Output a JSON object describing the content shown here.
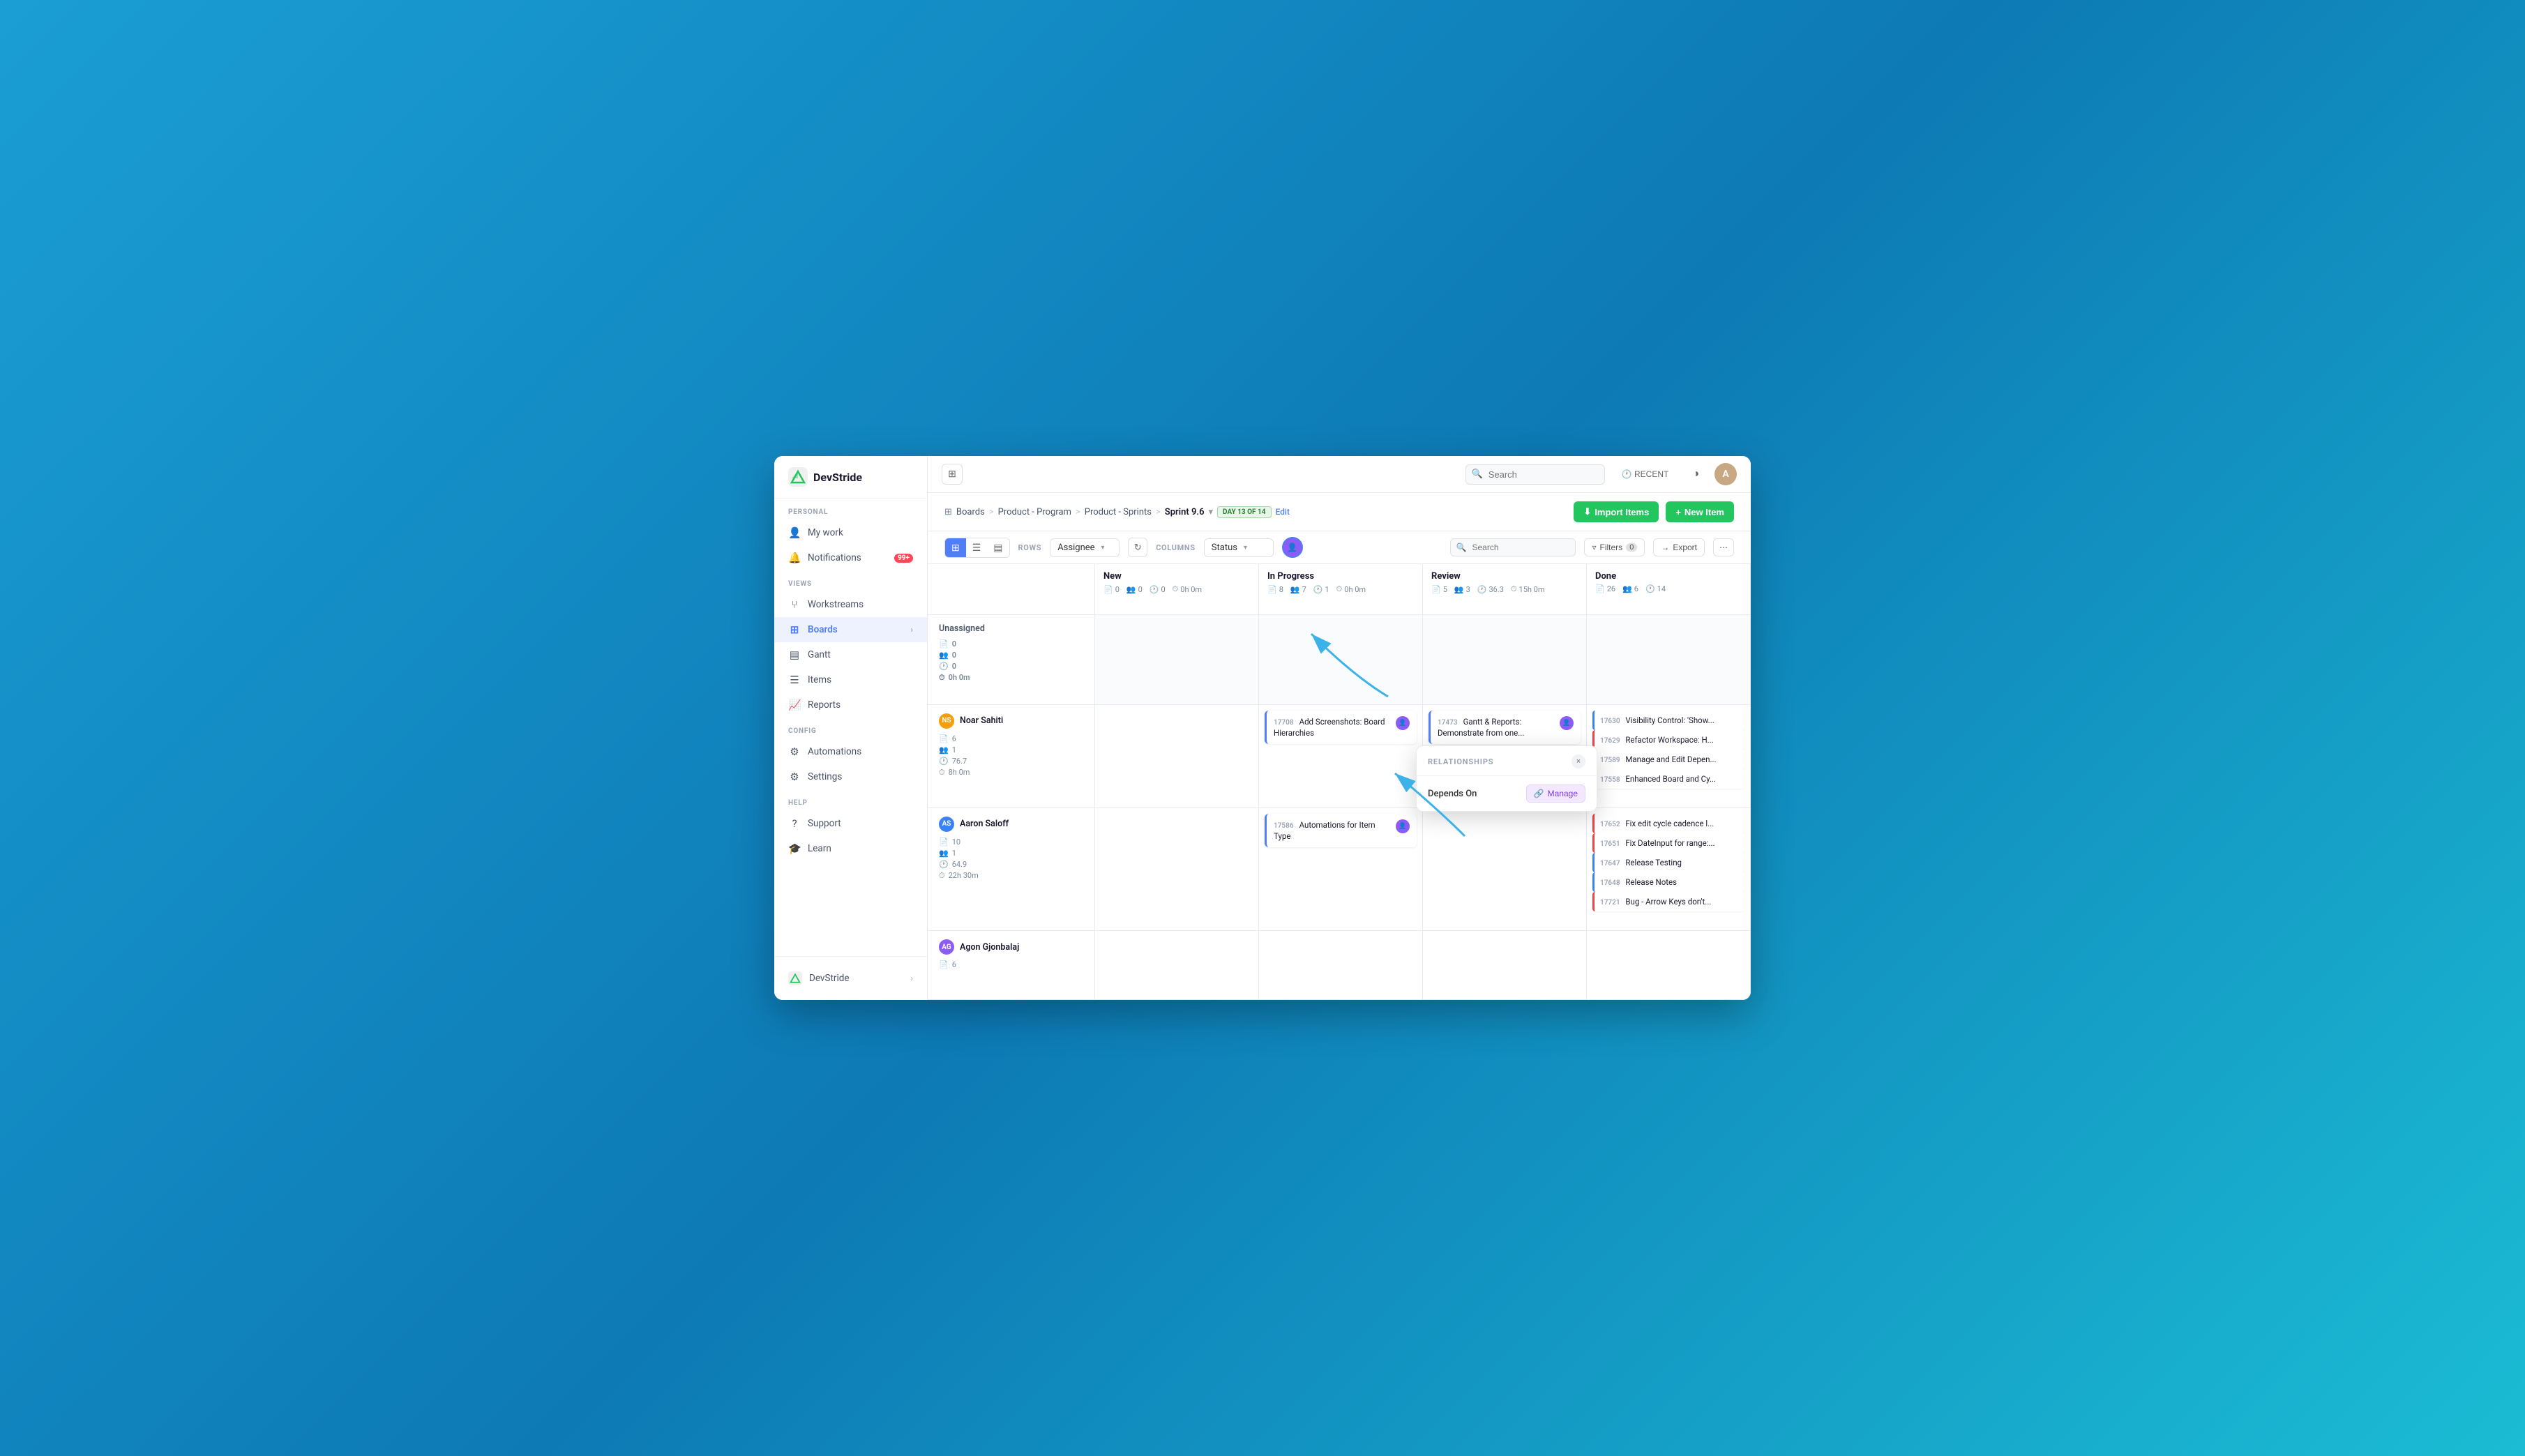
{
  "app": {
    "name": "DevStride",
    "logo_text": "DevStride"
  },
  "topbar": {
    "expand_icon": "⊞",
    "search_placeholder": "Search",
    "recent_label": "RECENT",
    "theme_icon": "◑",
    "avatar_letter": "A"
  },
  "breadcrumb": {
    "boards_label": "Boards",
    "sep1": ">",
    "program_label": "Product - Program",
    "sep2": ">",
    "sprints_label": "Product - Sprints",
    "sep3": ">",
    "sprint_label": "Sprint 9.6",
    "sprint_badge": "DAY 13 OF 14",
    "edit_label": "Edit"
  },
  "header_actions": {
    "import_label": "Import Items",
    "new_label": "New Item"
  },
  "toolbar": {
    "rows_label": "ROWS",
    "rows_value": "Assignee",
    "columns_label": "COLUMNS",
    "columns_value": "Status",
    "search_placeholder": "Search",
    "filters_label": "Filters",
    "filters_count": "0",
    "export_label": "Export"
  },
  "view_buttons": [
    "grid-icon",
    "list-icon",
    "table-icon"
  ],
  "board": {
    "columns": [
      {
        "id": "row-header",
        "title": "",
        "stats": []
      },
      {
        "id": "new",
        "title": "New",
        "stat_doc": "0",
        "stat_users": "0",
        "stat_clock": "0",
        "stat_time": "0h 0m"
      },
      {
        "id": "in-progress",
        "title": "In Progress",
        "stat_doc": "8",
        "stat_users": "7",
        "stat_clock": "1",
        "stat_time": "0h 0m"
      },
      {
        "id": "review",
        "title": "Review",
        "stat_doc": "5",
        "stat_users": "3",
        "stat_clock": "36.3",
        "stat_time": "15h 0m"
      },
      {
        "id": "done",
        "title": "Done",
        "stat_doc": "26",
        "stat_users": "6",
        "stat_clock": "14",
        "stat_time": ""
      }
    ],
    "rows": [
      {
        "id": "unassigned",
        "name": "Unassigned",
        "avatar_text": "",
        "avatar_color": "#e0e0e0",
        "stat_doc": "0",
        "stat_users": "0",
        "stat_clock": "0",
        "stat_time": "0h 0m",
        "new_cards": [],
        "in_progress_cards": [],
        "review_cards": [],
        "done_cards": []
      },
      {
        "id": "noar-sahiti",
        "name": "Noar Sahiti",
        "avatar_text": "NS",
        "avatar_color": "#f59e0b",
        "stat_doc": "6",
        "stat_users": "1",
        "stat_clock": "76.7",
        "stat_time": "8h 0m",
        "new_cards": [],
        "in_progress_cards": [
          {
            "id": "17708",
            "title": "Add Screenshots: Board Hierarchies",
            "color": "#4f7ef8"
          }
        ],
        "review_cards": [
          {
            "id": "17473",
            "title": "Gantt & Reports: Demonstrate from one...",
            "color": "#4f7ef8"
          }
        ],
        "done_cards": [
          {
            "id": "17630",
            "title": "Visibility Control: 'Show...",
            "color": "#3b82f6"
          }
        ]
      },
      {
        "id": "aaron-saloff",
        "name": "Aaron Saloff",
        "avatar_text": "AS",
        "avatar_color": "#3b82f6",
        "stat_doc": "10",
        "stat_users": "1",
        "stat_clock": "64.9",
        "stat_time": "22h 30m",
        "new_cards": [],
        "in_progress_cards": [
          {
            "id": "17586",
            "title": "Automations for Item Type",
            "color": "#4f7ef8"
          }
        ],
        "review_cards": [],
        "done_cards": [
          {
            "id": "17652",
            "title": "Fix edit cycle cadence l...",
            "color": "#ef4444"
          },
          {
            "id": "17651",
            "title": "Fix DateInput for range:...",
            "color": "#ef4444"
          },
          {
            "id": "17647",
            "title": "Release Testing",
            "color": "#3b82f6"
          },
          {
            "id": "17648",
            "title": "Release Notes",
            "color": "#3b82f6"
          },
          {
            "id": "17721",
            "title": "Bug - Arrow Keys don't...",
            "color": "#ef4444"
          }
        ]
      },
      {
        "id": "agon-gjonbalaj",
        "name": "Agon Gjonbalaj",
        "avatar_text": "AG",
        "avatar_color": "#8b5cf6",
        "stat_doc": "6",
        "stat_users": "",
        "stat_clock": "",
        "stat_time": "",
        "new_cards": [],
        "in_progress_cards": [],
        "review_cards": [],
        "done_cards": []
      }
    ]
  },
  "relationships_popup": {
    "title": "RELATIONSHIPS",
    "close_icon": "×",
    "depends_on_label": "Depends On",
    "manage_label": "Manage"
  },
  "sidebar": {
    "personal_label": "PERSONAL",
    "views_label": "VIEWS",
    "config_label": "CONFIG",
    "help_label": "HELP",
    "items": [
      {
        "id": "my-work",
        "label": "My work",
        "icon": "👤"
      },
      {
        "id": "notifications",
        "label": "Notifications",
        "icon": "🔔",
        "badge": "99+"
      },
      {
        "id": "workstreams",
        "label": "Workstreams",
        "icon": "⑂"
      },
      {
        "id": "boards",
        "label": "Boards",
        "icon": "⊞",
        "active": true
      },
      {
        "id": "gantt",
        "label": "Gantt",
        "icon": "▤"
      },
      {
        "id": "items",
        "label": "Items",
        "icon": "☰"
      },
      {
        "id": "reports",
        "label": "Reports",
        "icon": "📈"
      },
      {
        "id": "automations",
        "label": "Automations",
        "icon": "⚙"
      },
      {
        "id": "settings",
        "label": "Settings",
        "icon": "⚙"
      },
      {
        "id": "support",
        "label": "Support",
        "icon": "?"
      },
      {
        "id": "learn",
        "label": "Learn",
        "icon": "🎓"
      }
    ],
    "bottom_label": "DevStride"
  },
  "done_extra": [
    {
      "id": "17629",
      "title": "Refactor Workspace: H...",
      "color": "#ef4444"
    },
    {
      "id": "17589",
      "title": "Manage and Edit Depen...",
      "color": "#3b82f6"
    },
    {
      "id": "17558",
      "title": "Enhanced Board and Cy...",
      "color": "#3b82f6"
    }
  ]
}
